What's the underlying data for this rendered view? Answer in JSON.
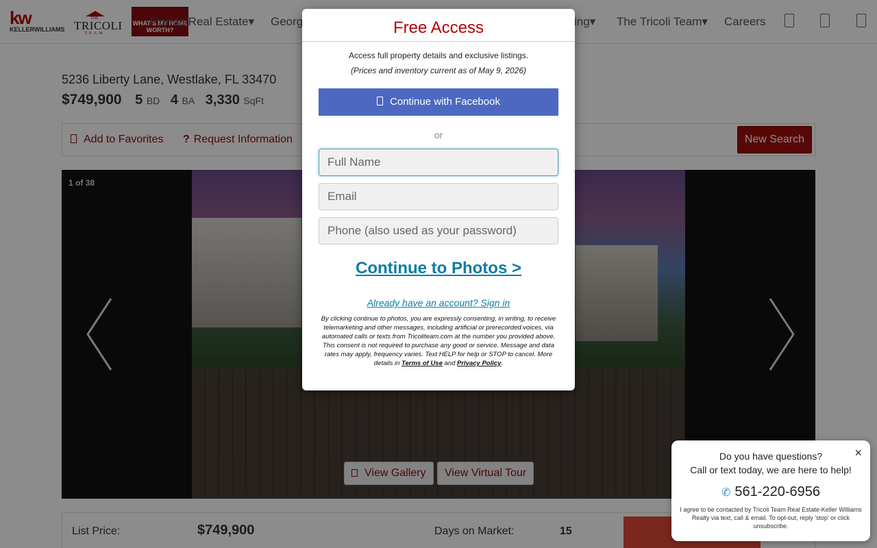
{
  "header": {
    "kw_logo_text": "KELLERWILLIAMS",
    "kw_mark": "kw",
    "tricoli_the": "THE",
    "tricoli_name": "TRICOLI",
    "tricoli_team": "TEAM",
    "worth_logo_text": "WHAT'S MY HOME WORTH?",
    "nav": [
      {
        "label": "Florida Real Estate▾"
      },
      {
        "label": "Georg"
      },
      {
        "label": "ing▾"
      },
      {
        "label": "The Tricoli Team▾"
      },
      {
        "label": "Careers"
      }
    ],
    "icons": [
      "user-icon",
      "heart-icon",
      "menu-icon"
    ]
  },
  "listing": {
    "address": "5236 Liberty Lane, Westlake, FL 33470",
    "price": "$749,900",
    "beds": "5",
    "beds_unit": "BD",
    "baths": "4",
    "baths_unit": "BA",
    "sqft": "3,330",
    "sqft_unit": "SqFt"
  },
  "toolbar": {
    "favorites": "Add to Favorites",
    "request": "Request Information",
    "new_search": "New Search"
  },
  "gallery": {
    "counter": "1 of 38",
    "view_gallery": "View Gallery",
    "view_tour": "View Virtual Tour"
  },
  "details": {
    "list_price_label": "List Price:",
    "list_price_value": "$749,900",
    "dom_label": "Days on Market:",
    "dom_value": "15"
  },
  "modal": {
    "title": "Free Access",
    "subtitle": "Access full property details and exclusive listings.",
    "date_note": "(Prices and inventory current as of May 9, 2026)",
    "facebook": "Continue with Facebook",
    "or": "or",
    "name_placeholder": "Full Name",
    "email_placeholder": "Email",
    "phone_placeholder": "Phone (also used as your password)",
    "cta": "Continue to Photos >",
    "signin": "Already have an account? Sign in",
    "legal_text": "By clicking continue to photos, you are expressly consenting, in writing, to receive telemarketing and other messages, including artificial or prerecorded voices, via automated calls or texts from Tricoliteam.com at the number you provided above. This consent is not required to purchase any good or service. Message and data rates may apply, frequency varies. Text HELP for help or STOP to cancel. More details in",
    "terms": "Terms of Use",
    "and": "and",
    "privacy": "Privacy Policy",
    "period": "."
  },
  "chat": {
    "close": "×",
    "question": "Do you have questions?",
    "help": "Call or text today, we are here to help!",
    "phone": "561-220-6956",
    "legal": "I agree to be contacted by Tricoli Team Real Estate-Keller Williams Realty via text, call & email. To opt-out, reply 'stop' or click unsubscribe."
  },
  "colors": {
    "brand_red": "#b40101",
    "facebook_blue": "#4c68c1",
    "link_teal": "#0e7da3"
  }
}
